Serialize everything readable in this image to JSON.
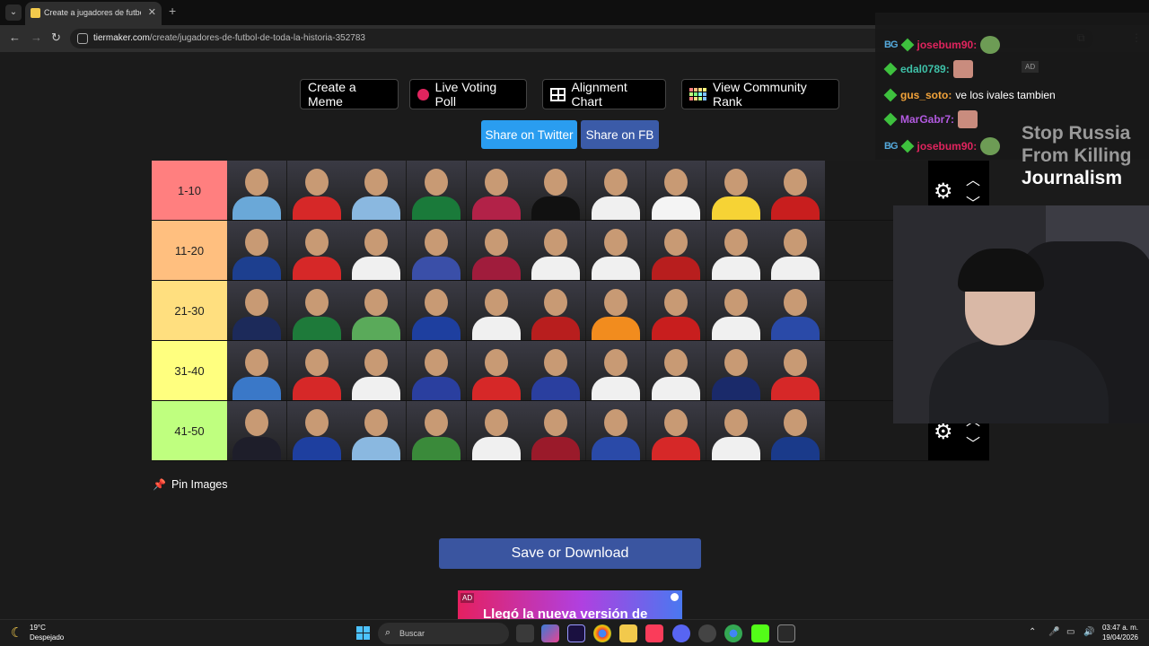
{
  "browser": {
    "tab_title": "Create a jugadores de futbol de",
    "url_host": "tiermaker.com",
    "url_path": "/create/jugadores-de-futbol-de-toda-la-historia-352783"
  },
  "toolbar_buttons": {
    "create_meme": "Create a Meme",
    "live_voting": "Live Voting Poll",
    "alignment_chart": "Alignment Chart",
    "community_rank": "View Community Rank",
    "share_twitter": "Share on Twitter",
    "share_fb": "Share on FB"
  },
  "tiers": [
    {
      "label": "1-10",
      "color": "#ff7f7f",
      "shirts": [
        "#6aa8d8",
        "#d62828",
        "#8ab8e0",
        "#1a7a3a",
        "#b22248",
        "#111111",
        "#f0f0f0",
        "#f4f4f4",
        "#f6d335",
        "#c81e1e"
      ]
    },
    {
      "label": "11-20",
      "color": "#ffbf7f",
      "shirts": [
        "#1d3f8f",
        "#d62828",
        "#f0f0f0",
        "#3a4fa8",
        "#a01c3c",
        "#f0f0f0",
        "#f0f0f0",
        "#b81e1e",
        "#f0f0f0",
        "#f0f0f0"
      ]
    },
    {
      "label": "21-30",
      "color": "#ffdf7f",
      "shirts": [
        "#1c2a5a",
        "#1e7a3a",
        "#5aaa5a",
        "#1e3f9f",
        "#f0f0f0",
        "#b81e1e",
        "#f28c1e",
        "#c81e1e",
        "#f0f0f0",
        "#2a4aa8"
      ]
    },
    {
      "label": "31-40",
      "color": "#ffff7f",
      "shirts": [
        "#3a78c8",
        "#d62828",
        "#f0f0f0",
        "#2a3f9f",
        "#d62828",
        "#2a3f9f",
        "#f0f0f0",
        "#f0f0f0",
        "#1a2a6a",
        "#d62828"
      ]
    },
    {
      "label": "41-50",
      "color": "#bfff7f",
      "shirts": [
        "#1e1e2a",
        "#1e3f9f",
        "#8ab8e0",
        "#3a8a3a",
        "#f0f0f0",
        "#9a1a2a",
        "#2a4aa8",
        "#d62828",
        "#f0f0f0",
        "#1a3a8a"
      ]
    }
  ],
  "pin_images": "Pin Images",
  "save_download": "Save or Download",
  "ad": {
    "tag": "AD",
    "text": "Llegó la nueva versión de"
  },
  "chat": [
    {
      "badges": "bg",
      "user": "josebum90:",
      "user_color": "#e0245e",
      "text": "",
      "emote": "green"
    },
    {
      "badges": "",
      "user": "edal0789:",
      "user_color": "#3ec1a8",
      "text": "",
      "emote": "face"
    },
    {
      "badges": "",
      "user": "gus_soto:",
      "user_color": "#f2a33a",
      "text": "ve los ivales tambien",
      "emote": ""
    },
    {
      "badges": "",
      "user": "MarGabr7:",
      "user_color": "#b25ae0",
      "text": "",
      "emote": "face"
    },
    {
      "badges": "bg",
      "user": "josebum90:",
      "user_color": "#e0245e",
      "text": "",
      "emote": "green"
    }
  ],
  "chat_ad_tag": "AD",
  "banner": {
    "line1": "Stop Russia",
    "line2": "From Killing",
    "line3": "Journalism"
  },
  "taskbar": {
    "temp": "19°C",
    "weather": "Despejado",
    "search": "Buscar",
    "time": "03:47 a. m.",
    "date": "19/04/2026"
  }
}
